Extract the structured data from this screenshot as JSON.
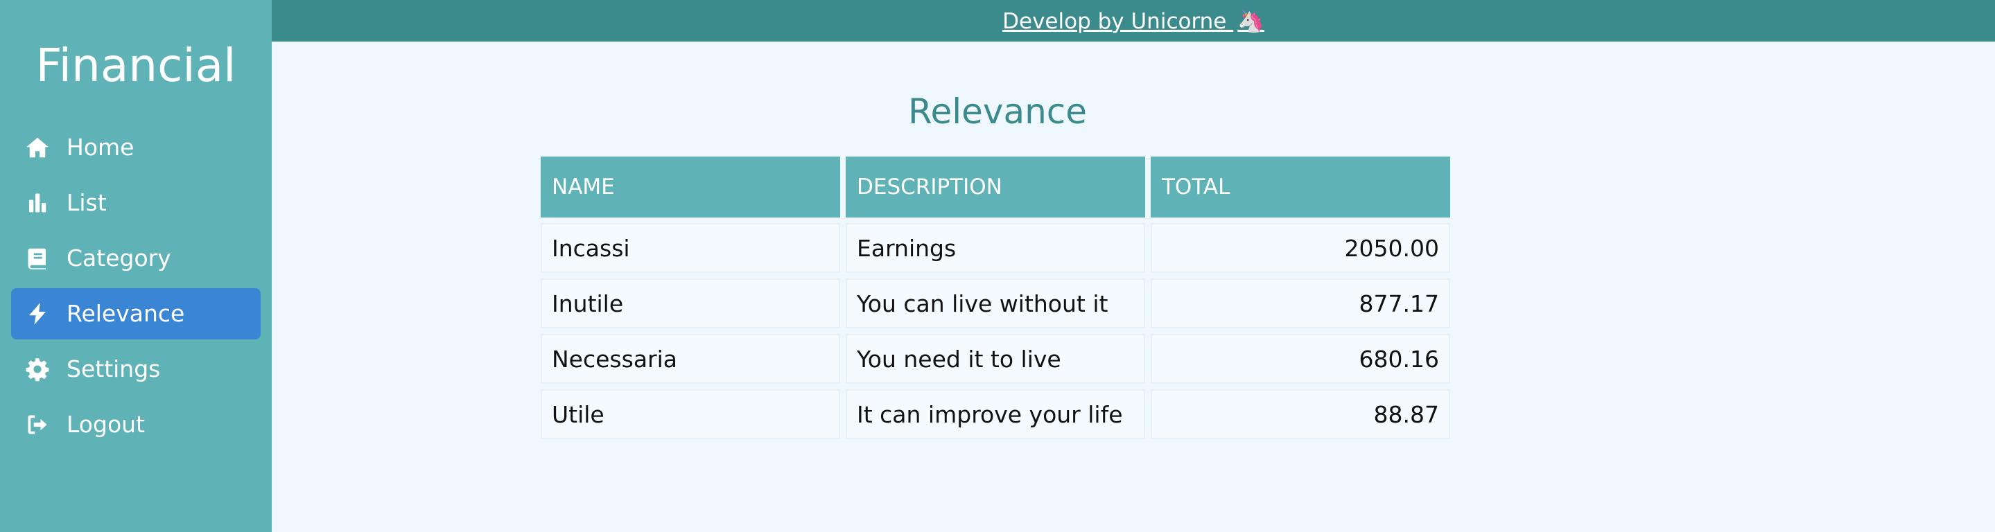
{
  "app": {
    "title": "Financial"
  },
  "sidebar": {
    "items": [
      {
        "label": "Home",
        "icon": "home-icon",
        "active": false
      },
      {
        "label": "List",
        "icon": "bar-chart-icon",
        "active": false
      },
      {
        "label": "Category",
        "icon": "book-icon",
        "active": false
      },
      {
        "label": "Relevance",
        "icon": "bolt-icon",
        "active": true
      },
      {
        "label": "Settings",
        "icon": "gear-icon",
        "active": false
      },
      {
        "label": "Logout",
        "icon": "logout-icon",
        "active": false
      }
    ]
  },
  "header": {
    "credit_text": "Develop by Unicorne",
    "credit_emoji": "🦄"
  },
  "main": {
    "title": "Relevance",
    "table": {
      "headers": [
        "NAME",
        "DESCRIPTION",
        "TOTAL"
      ],
      "rows": [
        [
          "Incassi",
          "Earnings",
          "2050.00"
        ],
        [
          "Inutile",
          "You can live without it",
          "877.17"
        ],
        [
          "Necessaria",
          "You need it to live",
          "680.16"
        ],
        [
          "Utile",
          "It can improve your life",
          "88.87"
        ]
      ]
    }
  },
  "colors": {
    "sidebar": "#5fb2b5",
    "topbar": "#3b8a8c",
    "active": "#3a86d5",
    "background": "#f0f8ff"
  }
}
